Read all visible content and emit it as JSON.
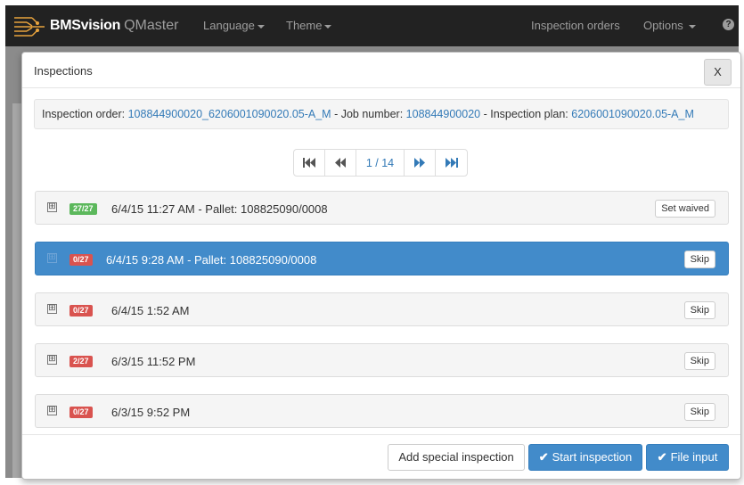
{
  "navbar": {
    "brand_bold": "BMSvision",
    "brand_light": "QMaster",
    "language_label": "Language",
    "theme_label": "Theme",
    "inspection_orders_label": "Inspection orders",
    "options_label": "Options",
    "help_icon": "?"
  },
  "modal": {
    "title": "Inspections",
    "close_label": "X",
    "info": {
      "order_label": "Inspection order: ",
      "order_value": "108844900020_6206001090020.05-A_M",
      "job_label": " - Job number: ",
      "job_value": "108844900020",
      "plan_label": " - Inspection plan: ",
      "plan_value": "6206001090020.05-A_M"
    },
    "pager": {
      "first_icon": "first-page-icon",
      "prev_icon": "previous-page-icon",
      "info": "1 / 14",
      "next_icon": "next-page-icon",
      "last_icon": "last-page-icon"
    },
    "rows": [
      {
        "badge": "27/27",
        "badge_color": "#5cb85c",
        "text": "6/4/15 11:27 AM - Pallet: 108825090/0008",
        "button": "Set waived",
        "active": false
      },
      {
        "badge": "0/27",
        "badge_color": "#d9534f",
        "text": "6/4/15 9:28 AM - Pallet: 108825090/0008",
        "button": "Skip",
        "active": true
      },
      {
        "badge": "0/27",
        "badge_color": "#d9534f",
        "text": "6/4/15 1:52 AM",
        "button": "Skip",
        "active": false
      },
      {
        "badge": "2/27",
        "badge_color": "#d9534f",
        "text": "6/3/15 11:52 PM",
        "button": "Skip",
        "active": false
      },
      {
        "badge": "0/27",
        "badge_color": "#d9534f",
        "text": "6/3/15 9:52 PM",
        "button": "Skip",
        "active": false
      }
    ],
    "expand_symbol": "⊞",
    "footer": {
      "add_special_label": "Add special inspection",
      "start_label": "Start inspection",
      "file_input_label": "File input"
    }
  },
  "colors": {
    "primary": "#428bca",
    "navbar": "#222222",
    "success": "#5cb85c",
    "danger": "#d9534f"
  }
}
